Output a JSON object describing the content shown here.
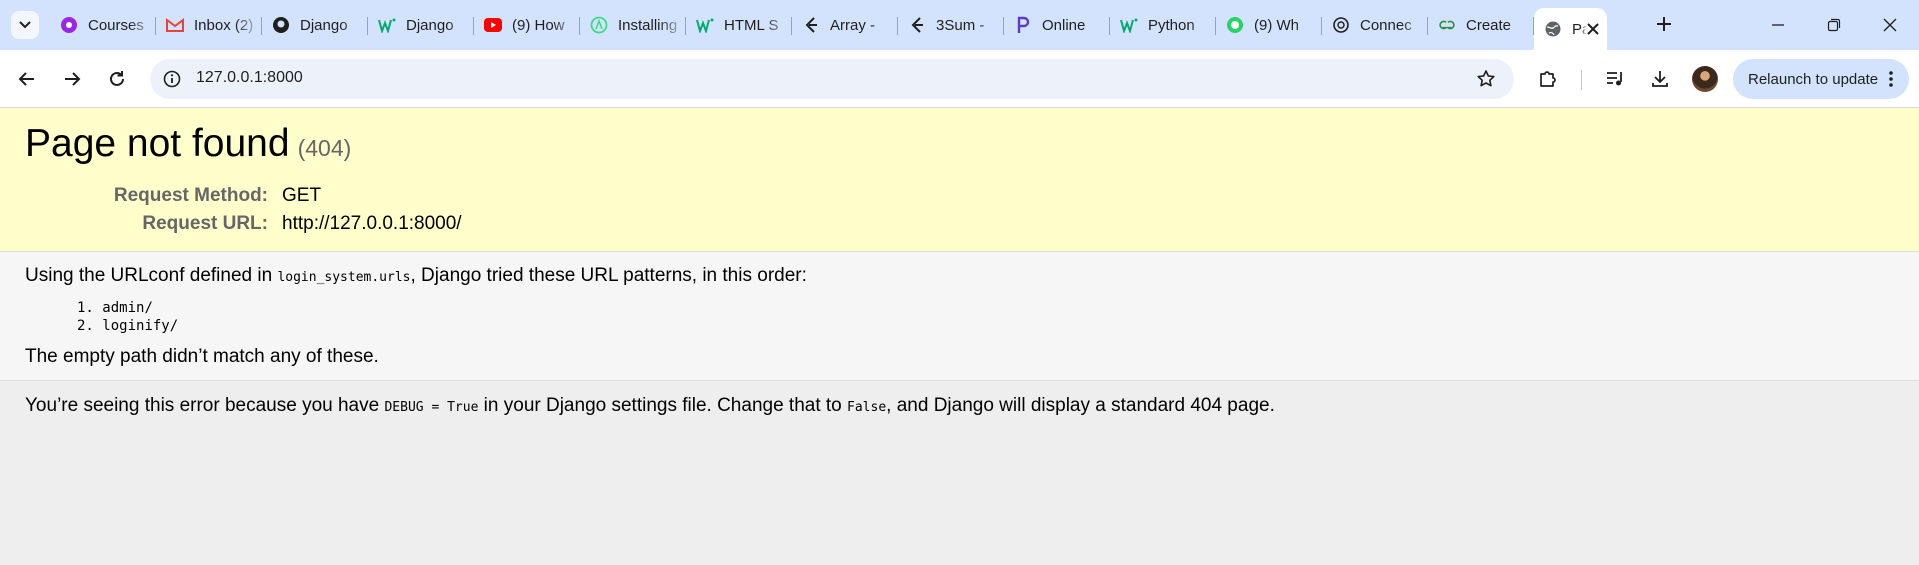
{
  "browser": {
    "tabs": [
      {
        "title": "Courses",
        "icon": "courses-icon",
        "color": "#9b27e6"
      },
      {
        "title": "Inbox (2)",
        "icon": "gmail-icon",
        "color": "#ea4335"
      },
      {
        "title": "Django",
        "icon": "github-icon",
        "color": "#1f1f1f"
      },
      {
        "title": "Django",
        "icon": "w3schools-icon",
        "color": "#04aa6d"
      },
      {
        "title": "(9) How",
        "icon": "youtube-icon",
        "color": "#ff0000"
      },
      {
        "title": "Installing",
        "icon": "android-icon",
        "color": "#3ddc84"
      },
      {
        "title": "HTML S",
        "icon": "w3schools-icon",
        "color": "#04aa6d"
      },
      {
        "title": "Array -",
        "icon": "leetcode-icon",
        "color": "#1f1f1f"
      },
      {
        "title": "3Sum -",
        "icon": "leetcode-icon",
        "color": "#1f1f1f"
      },
      {
        "title": "Online",
        "icon": "programiz-icon",
        "color": "#5b3cc4"
      },
      {
        "title": "Python",
        "icon": "w3schools-icon",
        "color": "#04aa6d"
      },
      {
        "title": "(9) Wh",
        "icon": "whatsapp-icon",
        "color": "#25d366"
      },
      {
        "title": "Connec",
        "icon": "chatgpt-icon",
        "color": "#1f1f1f"
      },
      {
        "title": "Create",
        "icon": "geeksforgeeks-icon",
        "color": "#2f8d46"
      }
    ],
    "active_tab": {
      "title": "Page not found",
      "icon": "globe-icon"
    },
    "address": {
      "url": "127.0.0.1:8000"
    },
    "relaunch_label": "Relaunch to update"
  },
  "page": {
    "title": "Page not found",
    "status_code": "(404)",
    "meta": [
      {
        "label": "Request Method:",
        "value": "GET"
      },
      {
        "label": "Request URL:",
        "value": "http://127.0.0.1:8000/"
      }
    ],
    "urlconf_text_before": "Using the URLconf defined in ",
    "urlconf_module": "login_system.urls",
    "urlconf_text_after": ", Django tried these URL patterns, in this order:",
    "patterns": [
      {
        "num": "1.",
        "pattern": "admin/"
      },
      {
        "num": "2.",
        "pattern": "loginify/"
      }
    ],
    "no_match_text": "The empty path didn’t match any of these.",
    "debug_text_1": "You’re seeing this error because you have ",
    "debug_code": "DEBUG = True",
    "debug_text_2": " in your Django settings file. Change that to ",
    "debug_false": "False",
    "debug_text_3": ", and Django will display a standard 404 page."
  },
  "colors": {
    "tabstrip": "#d3e3fd",
    "summary_bg": "#ffffcc",
    "info_bg": "#f6f6f6",
    "explanation_bg": "#eeeeee",
    "label_gray": "#666666"
  }
}
